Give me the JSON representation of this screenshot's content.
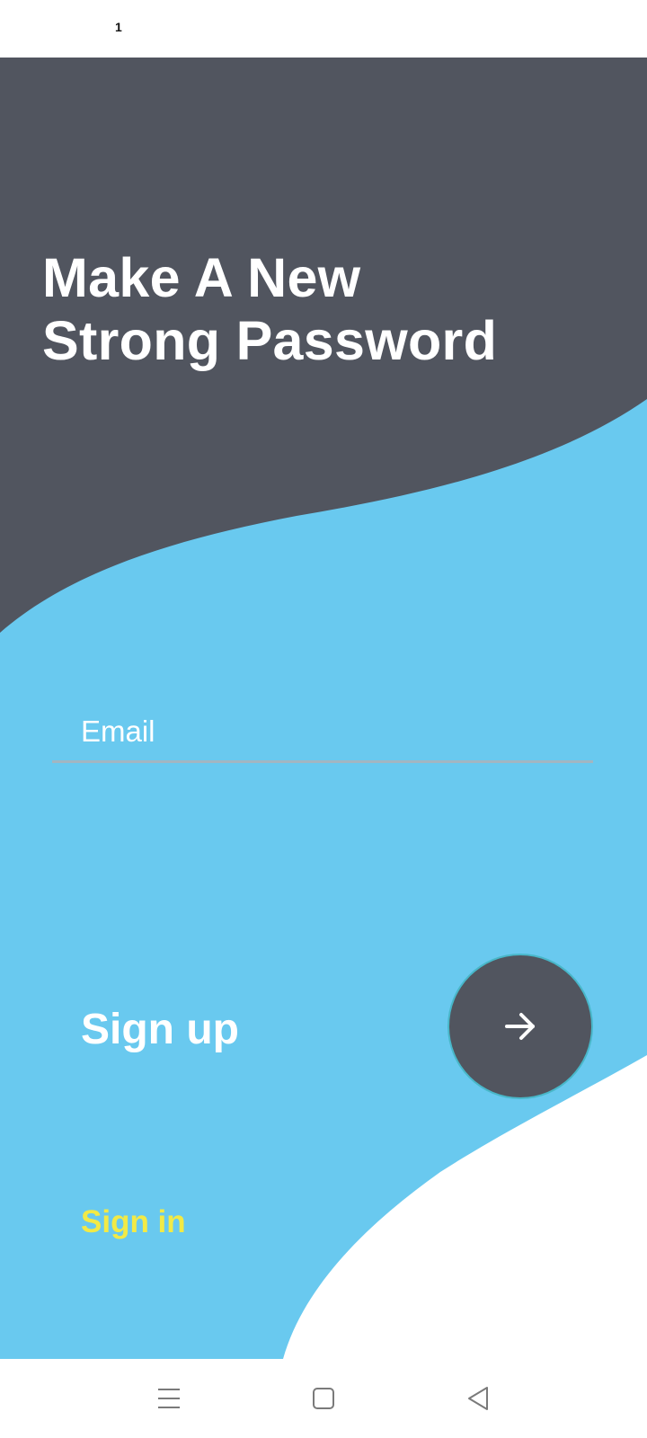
{
  "status_bar": {
    "text": "1"
  },
  "header": {
    "title_line1": "Make A New",
    "title_line2": "Strong Password"
  },
  "form": {
    "email_placeholder": "Email",
    "email_value": "",
    "signup_label": "Sign up",
    "submit_icon": "arrow-right-icon",
    "signin_link": "Sign in"
  },
  "navigation_bar": {
    "icons": [
      "menu-icon",
      "home-icon",
      "back-icon"
    ]
  },
  "colors": {
    "dark_panel": "#51555f",
    "light_blue": "#69c9ef",
    "accent_yellow": "#f2ea46",
    "text_white": "#ffffff"
  }
}
